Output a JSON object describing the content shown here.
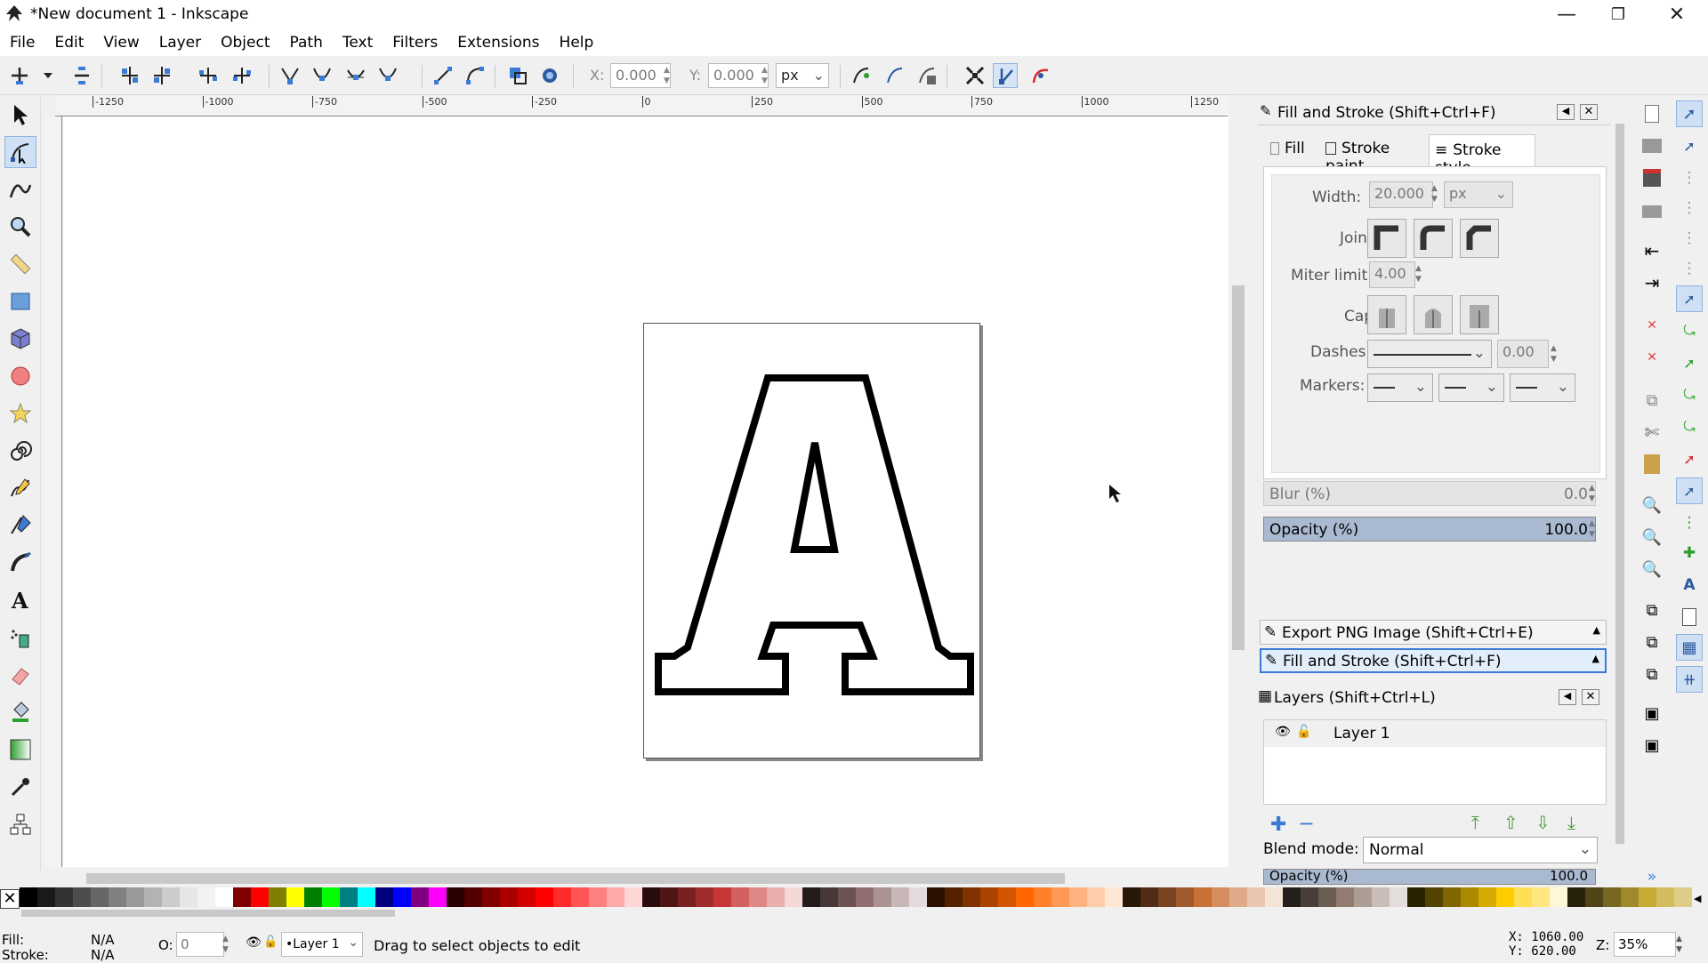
{
  "window": {
    "title": "*New document 1 - Inkscape",
    "minimize_icon": "minimize-icon",
    "maximize_icon": "restore-icon",
    "close_icon": "close-icon"
  },
  "menu": [
    "File",
    "Edit",
    "View",
    "Layer",
    "Object",
    "Path",
    "Text",
    "Filters",
    "Extensions",
    "Help"
  ],
  "toolbar": {
    "x_label": "X:",
    "x_value": "0.000",
    "y_label": "Y:",
    "y_value": "0.000",
    "unit": "px"
  },
  "ruler": {
    "h_ticks": [
      "-1250",
      "-1000",
      "-750",
      "-500",
      "-250",
      "0",
      "250",
      "500",
      "750",
      "1000",
      "1250"
    ]
  },
  "canvas": {
    "glyph": "A",
    "page_color": "#ffffff",
    "outline_color": "#000000"
  },
  "fill_stroke": {
    "title": "Fill and Stroke (Shift+Ctrl+F)",
    "tabs": [
      "Fill",
      "Stroke paint",
      "Stroke style"
    ],
    "active_tab": "Stroke style",
    "width_label": "Width:",
    "width_value": "20.000",
    "width_unit": "px",
    "join_label": "Join:",
    "miter_label": "Miter limit:",
    "miter_value": "4.00",
    "cap_label": "Cap:",
    "dashes_label": "Dashes:",
    "dashes_value": "0.00",
    "markers_label": "Markers:",
    "blur_label": "Blur (%)",
    "blur_value": "0.0",
    "opacity_label": "Opacity (%)",
    "opacity_value": "100.0"
  },
  "dock_sections": {
    "export": "Export PNG Image (Shift+Ctrl+E)",
    "fill_stroke": "Fill and Stroke (Shift+Ctrl+F)"
  },
  "layers": {
    "title": "Layers (Shift+Ctrl+L)",
    "items": [
      "Layer 1"
    ],
    "blend_label": "Blend mode:",
    "blend_value": "Normal",
    "opacity_label": "Opacity (%)",
    "opacity_value": "100.0"
  },
  "palette": [
    "#000000",
    "#1a1a1a",
    "#333333",
    "#4d4d4d",
    "#666666",
    "#808080",
    "#999999",
    "#b3b3b3",
    "#cccccc",
    "#e6e6e6",
    "#f2f2f2",
    "#ffffff",
    "#800000",
    "#ff0000",
    "#808000",
    "#ffff00",
    "#008000",
    "#00ff00",
    "#008080",
    "#00ffff",
    "#000080",
    "#0000ff",
    "#800080",
    "#ff00ff",
    "#2b0000",
    "#550000",
    "#800000",
    "#aa0000",
    "#d40000",
    "#ff0000",
    "#ff2a2a",
    "#ff5555",
    "#ff8080",
    "#ffaaaa",
    "#ffd5d5",
    "#280b0b",
    "#501616",
    "#782121",
    "#a02c2c",
    "#c83737",
    "#d35f5f",
    "#de8787",
    "#e9afaf",
    "#f4d7d7",
    "#241c1c",
    "#483737",
    "#6c5353",
    "#916f6f",
    "#ac9393",
    "#c8b7b7",
    "#e3dbdb",
    "#2b1100",
    "#552200",
    "#803300",
    "#aa4400",
    "#d45500",
    "#ff6600",
    "#ff7f2a",
    "#ff9955",
    "#ffb380",
    "#ffccaa",
    "#ffe6d5",
    "#28170b",
    "#502d16",
    "#784421",
    "#a05a2c",
    "#c87137",
    "#d38d5f",
    "#deaa87",
    "#e9c6af",
    "#f4e3d7",
    "#241f1c",
    "#483e37",
    "#6c5d53",
    "#917c6f",
    "#ac9d93",
    "#c8beb7",
    "#e3dedb",
    "#2b2200",
    "#554400",
    "#806600",
    "#aa8800",
    "#d4aa00",
    "#ffcc00",
    "#ffdd55",
    "#ffe680",
    "#fff6d5",
    "#28220b",
    "#504416",
    "#786721",
    "#a0892c",
    "#c8ab37",
    "#d3bc5f",
    "#decd87"
  ],
  "status": {
    "fill_label": "Fill:",
    "fill_value": "N/A",
    "stroke_label": "Stroke:",
    "stroke_value": "N/A",
    "o_label": "O:",
    "o_value": "0",
    "layer_value": "•Layer 1",
    "message": "Drag to select objects to edit",
    "x_coord": "X: 1060.00",
    "y_coord": "Y:  620.00",
    "zoom_label": "Z:",
    "zoom_value": "35%"
  }
}
